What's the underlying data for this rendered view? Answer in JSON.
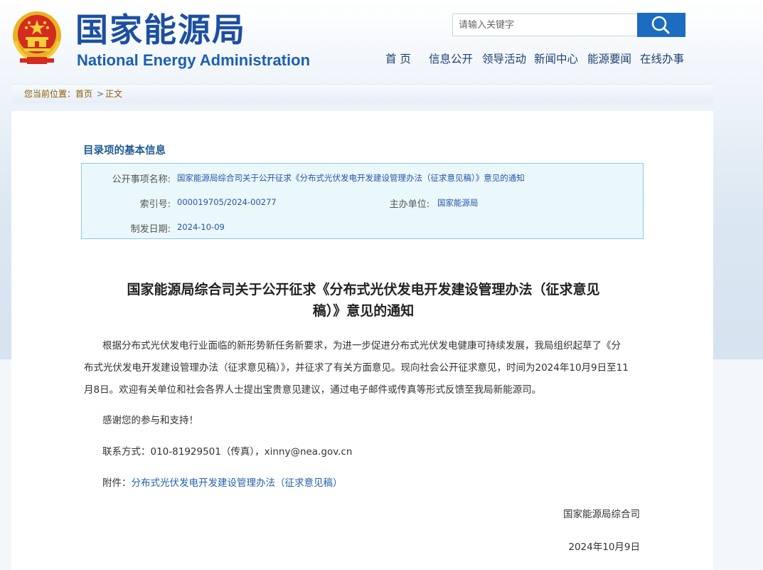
{
  "header": {
    "site_name_cn": "国家能源局",
    "site_name_en": "National Energy Administration",
    "emblem_icon": "national-emblem-icon",
    "search": {
      "placeholder": "请输入关键字",
      "icon": "search-icon"
    },
    "nav": [
      "首 页",
      "信息公开",
      "领导活动",
      "新闻中心",
      "能源要闻",
      "在线办事"
    ]
  },
  "breadcrumb": {
    "prefix": "您当前位置：",
    "home": "首页",
    "separator": ">",
    "current": "正文"
  },
  "info": {
    "heading": "目录项的基本信息",
    "labels": {
      "title": "公开事项名称:",
      "index": "索引号:",
      "dept": "主办单位:",
      "date": "制发日期:"
    },
    "values": {
      "title": "国家能源局综合司关于公开征求《分布式光伏发电开发建设管理办法（征求意见稿）》意见的通知",
      "index": "000019705/2024-00277",
      "dept": "国家能源局",
      "date": "2024-10-09"
    }
  },
  "article": {
    "title_line1": "国家能源局综合司关于公开征求《分布式光伏发电开发建设管理办法（征求意见",
    "title_line2": "稿）》意见的通知",
    "para1_line1": "根据分布式光伏发电行业面临的新形势新任务新要求，为进一步促进分布式光伏发电健康可持续发展，我局组织起草了《分",
    "para1_line2": "布式光伏发电开发建设管理办法（征求意见稿）》，并征求了有关方面意见。现向社会公开征求意见，时间为2024年10月9日至11",
    "para1_line3": "月8日。欢迎有关单位和社会各界人士提出宝贵意见建议，通过电子邮件或传真等形式反馈至我局新能源司。",
    "thanks": "感谢您的参与和支持！",
    "contact": "联系方式：010-81929501（传真），xinny@nea.gov.cn",
    "attachment_label": "附件：",
    "attachment_link": "分布式光伏发电开发建设管理办法（征求意见稿）",
    "signature_org": "国家能源局综合司",
    "signature_date": "2024年10月9日"
  },
  "colors": {
    "brand_blue": "#1d4fa0",
    "link_blue": "#2655a8",
    "search_button": "#1c6cc0",
    "info_box_bg": "#eaf7fb"
  }
}
